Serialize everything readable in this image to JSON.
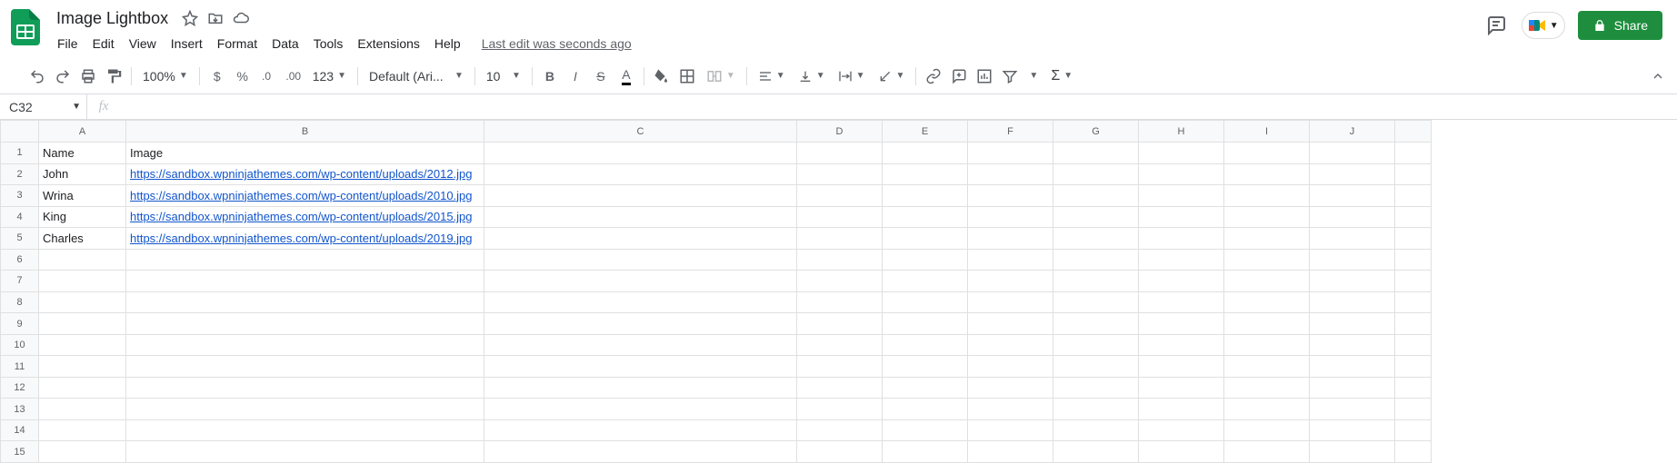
{
  "doc_title": "Image Lightbox",
  "menus": [
    "File",
    "Edit",
    "View",
    "Insert",
    "Format",
    "Data",
    "Tools",
    "Extensions",
    "Help"
  ],
  "last_edit": "Last edit was seconds ago",
  "share_label": "Share",
  "zoom": "100%",
  "font_name": "Default (Ari...",
  "font_size": "10",
  "namebox": "C32",
  "formula": "",
  "columns": [
    "A",
    "B",
    "C",
    "D",
    "E",
    "F",
    "G",
    "H",
    "I",
    "J"
  ],
  "row_count": 15,
  "data_rows": [
    {
      "A": {
        "text": "Name",
        "bold": true
      },
      "B": {
        "text": "Image",
        "bold": true
      }
    },
    {
      "A": {
        "text": "John"
      },
      "B": {
        "text": "https://sandbox.wpninjathemes.com/wp-content/uploads/2012.jpg",
        "link": true
      }
    },
    {
      "A": {
        "text": "Wrina"
      },
      "B": {
        "text": "https://sandbox.wpninjathemes.com/wp-content/uploads/2010.jpg",
        "link": true
      }
    },
    {
      "A": {
        "text": "King"
      },
      "B": {
        "text": "https://sandbox.wpninjathemes.com/wp-content/uploads/2015.jpg",
        "link": true
      }
    },
    {
      "A": {
        "text": "Charles"
      },
      "B": {
        "text": "https://sandbox.wpninjathemes.com/wp-content/uploads/2019.jpg",
        "link": true
      }
    }
  ],
  "format_number_label": "123",
  "toolbar_icons": {
    "undo": "undo",
    "redo": "redo",
    "print": "print",
    "paint": "paint-format",
    "currency": "$",
    "percent": "%",
    "dec_less": ".0",
    "dec_more": ".00",
    "bold": "B",
    "italic": "I",
    "strike": "S",
    "textcolor": "A",
    "fill": "fill",
    "borders": "borders",
    "merge": "merge",
    "halign": "align-left",
    "valign": "align-bottom",
    "wrap": "wrap",
    "rotate": "rotate",
    "link": "link",
    "comment": "comment",
    "chart": "chart",
    "filter": "filter",
    "filter_dd": "filter-views",
    "functions": "Σ"
  }
}
